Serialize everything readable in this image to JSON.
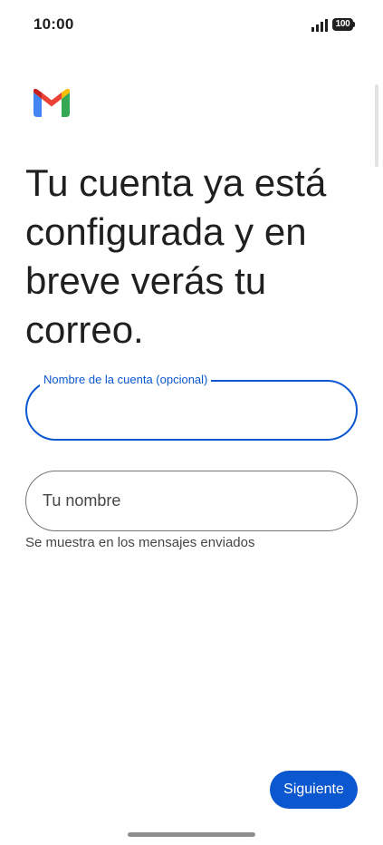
{
  "status_bar": {
    "time": "10:00",
    "battery_level": "100"
  },
  "app": {
    "logo_icon": "gmail-logo-icon"
  },
  "headline": "Tu cuenta ya está configurada y en breve verás tu correo.",
  "fields": {
    "account_name": {
      "label": "Nombre de la cuenta (opcional)",
      "value": ""
    },
    "your_name": {
      "placeholder": "Tu nombre",
      "value": "",
      "helper": "Se muestra en los mensajes enviados"
    }
  },
  "actions": {
    "next_label": "Siguiente"
  },
  "colors": {
    "accent": "#0b57d0",
    "outline": "#747775",
    "text": "#1f1f1f",
    "helper_text": "#444746"
  }
}
